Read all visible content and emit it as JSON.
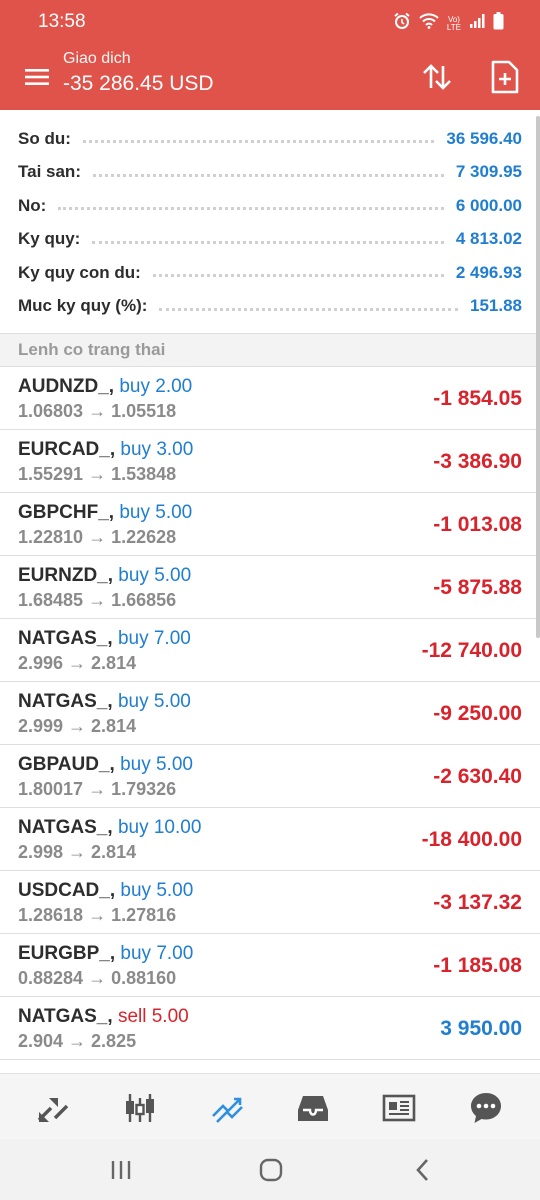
{
  "status_bar": {
    "time": "13:58",
    "icons": [
      "alarm-icon",
      "wifi-icon",
      "volte-icon",
      "signal-icon",
      "battery-icon"
    ],
    "volte_top": "Vo)",
    "volte_bottom": "LTE"
  },
  "app_bar": {
    "title": "Giao dich",
    "subtitle": "-35 286.45 USD",
    "accent_color": "#e0534a"
  },
  "summary": [
    {
      "label": "So du:",
      "value": "36 596.40"
    },
    {
      "label": "Tai san:",
      "value": "7 309.95"
    },
    {
      "label": "No:",
      "value": "6 000.00"
    },
    {
      "label": "Ky quy:",
      "value": "4 813.02"
    },
    {
      "label": "Ky quy con du:",
      "value": "2 496.93"
    },
    {
      "label": "Muc ky quy (%):",
      "value": "151.88"
    }
  ],
  "section_title": "Lenh co trang thai",
  "orders": [
    {
      "symbol": "AUDNZD_,",
      "side": "buy 2.00",
      "prices": "1.06803 → 1.05518",
      "profit": "-1 854.05"
    },
    {
      "symbol": "EURCAD_,",
      "side": "buy 3.00",
      "prices": "1.55291 → 1.53848",
      "profit": "-3 386.90"
    },
    {
      "symbol": "GBPCHF_,",
      "side": "buy 5.00",
      "prices": "1.22810 → 1.22628",
      "profit": "-1 013.08"
    },
    {
      "symbol": "EURNZD_,",
      "side": "buy 5.00",
      "prices": "1.68485 → 1.66856",
      "profit": "-5 875.88"
    },
    {
      "symbol": "NATGAS_,",
      "side": "buy 7.00",
      "prices": "2.996 → 2.814",
      "profit": "-12 740.00"
    },
    {
      "symbol": "NATGAS_,",
      "side": "buy 5.00",
      "prices": "2.999 → 2.814",
      "profit": "-9 250.00"
    },
    {
      "symbol": "GBPAUD_,",
      "side": "buy 5.00",
      "prices": "1.80017 → 1.79326",
      "profit": "-2 630.40"
    },
    {
      "symbol": "NATGAS_,",
      "side": "buy 10.00",
      "prices": "2.998 → 2.814",
      "profit": "-18 400.00"
    },
    {
      "symbol": "USDCAD_,",
      "side": "buy 5.00",
      "prices": "1.28618 → 1.27816",
      "profit": "-3 137.32"
    },
    {
      "symbol": "EURGBP_,",
      "side": "buy 7.00",
      "prices": "0.88284 → 0.88160",
      "profit": "-1 185.08"
    },
    {
      "symbol": "NATGAS_,",
      "side": "sell 5.00",
      "prices": "2.904 → 2.825",
      "profit": "3 950.00"
    }
  ],
  "bottom_nav": [
    "quotes-icon",
    "chart-icon",
    "trade-icon",
    "history-icon",
    "news-icon",
    "chat-icon"
  ],
  "colors": {
    "profit_negative": "#d9232c",
    "profit_positive": "#1f7ed0",
    "value_blue": "#1f7ed0",
    "active_nav": "#2f8fe0"
  }
}
